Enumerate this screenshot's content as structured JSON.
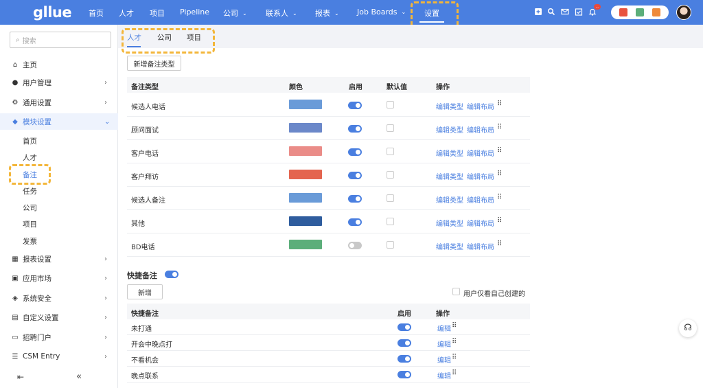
{
  "app": {
    "logo": "gllue"
  },
  "nav": {
    "items": [
      {
        "label": "首页",
        "dropdown": false
      },
      {
        "label": "人才",
        "dropdown": false
      },
      {
        "label": "项目",
        "dropdown": false
      },
      {
        "label": "Pipeline",
        "dropdown": false
      },
      {
        "label": "公司",
        "dropdown": true
      },
      {
        "label": "联系人",
        "dropdown": true
      },
      {
        "label": "报表",
        "dropdown": true
      },
      {
        "label": "Job Boards",
        "dropdown": true
      },
      {
        "label": "设置",
        "dropdown": false,
        "active": true
      }
    ],
    "chevron": "⌄",
    "notification_badge": "…",
    "icons": [
      "plus-icon",
      "search-icon",
      "mail-icon",
      "calendar-check-icon",
      "bell-icon"
    ]
  },
  "sidebar": {
    "search_placeholder": "搜索",
    "items": [
      {
        "label": "主页",
        "icon": "home-icon",
        "glyph": "⌂",
        "arrow": ""
      },
      {
        "label": "用户管理",
        "icon": "user-icon",
        "glyph": "●",
        "arrow": "›"
      },
      {
        "label": "通用设置",
        "icon": "gear-icon",
        "glyph": "⚙",
        "arrow": "›"
      },
      {
        "label": "模块设置",
        "icon": "graduation-cap-icon",
        "glyph": "◆",
        "arrow": "⌄",
        "active": true
      },
      {
        "label": "报表设置",
        "icon": "chart-icon",
        "glyph": "▦",
        "arrow": "›"
      },
      {
        "label": "应用市场",
        "icon": "store-icon",
        "glyph": "▣",
        "arrow": "›"
      },
      {
        "label": "系统安全",
        "icon": "shield-icon",
        "glyph": "◈",
        "arrow": "›"
      },
      {
        "label": "自定义设置",
        "icon": "dashboard-icon",
        "glyph": "▤",
        "arrow": "›"
      },
      {
        "label": "招聘门户",
        "icon": "monitor-icon",
        "glyph": "▭",
        "arrow": "›"
      },
      {
        "label": "CSM Entry",
        "icon": "list-icon",
        "glyph": "☰",
        "arrow": "›"
      }
    ],
    "sub_items": [
      "首页",
      "人才",
      "备注",
      "任务",
      "公司",
      "项目",
      "发票"
    ],
    "current_sub": "备注",
    "footer": {
      "outdent_glyph": "⇤",
      "collapse_glyph": "«"
    }
  },
  "tabs": [
    {
      "label": "人才",
      "active": true
    },
    {
      "label": "公司",
      "active": false
    },
    {
      "label": "项目",
      "active": false
    }
  ],
  "note_types": {
    "add_button": "新增备注类型",
    "columns": [
      "备注类型",
      "颜色",
      "启用",
      "默认值",
      "操作"
    ],
    "rows": [
      {
        "name": "候选人电话",
        "color": "#6a9bd8",
        "enabled": true,
        "default": false
      },
      {
        "name": "顾问面试",
        "color": "#6b88c9",
        "enabled": true,
        "default": false
      },
      {
        "name": "客户电话",
        "color": "#ea8c88",
        "enabled": true,
        "default": false
      },
      {
        "name": "客户拜访",
        "color": "#e4654f",
        "enabled": true,
        "default": false
      },
      {
        "name": "候选人备注",
        "color": "#6a9bd8",
        "enabled": true,
        "default": false
      },
      {
        "name": "其他",
        "color": "#2f5d9e",
        "enabled": true,
        "default": false
      },
      {
        "name": "BD电话",
        "color": "#5cae7a",
        "enabled": false,
        "default": false
      }
    ],
    "action_edit_type": "编辑类型",
    "action_edit_layout": "编辑布局",
    "drag_handle": "⠿"
  },
  "quick_notes": {
    "title": "快捷备注",
    "enabled": true,
    "add_button": "新增",
    "own_only_label": "用户仅看自己创建的",
    "columns": [
      "快捷备注",
      "启用",
      "操作"
    ],
    "rows": [
      {
        "name": "未打通",
        "enabled": true
      },
      {
        "name": "开会中晚点打",
        "enabled": true
      },
      {
        "name": "不看机会",
        "enabled": true
      },
      {
        "name": "晚点联系",
        "enabled": true
      }
    ],
    "action_edit": "编辑"
  },
  "support": {
    "glyph": "☊"
  }
}
